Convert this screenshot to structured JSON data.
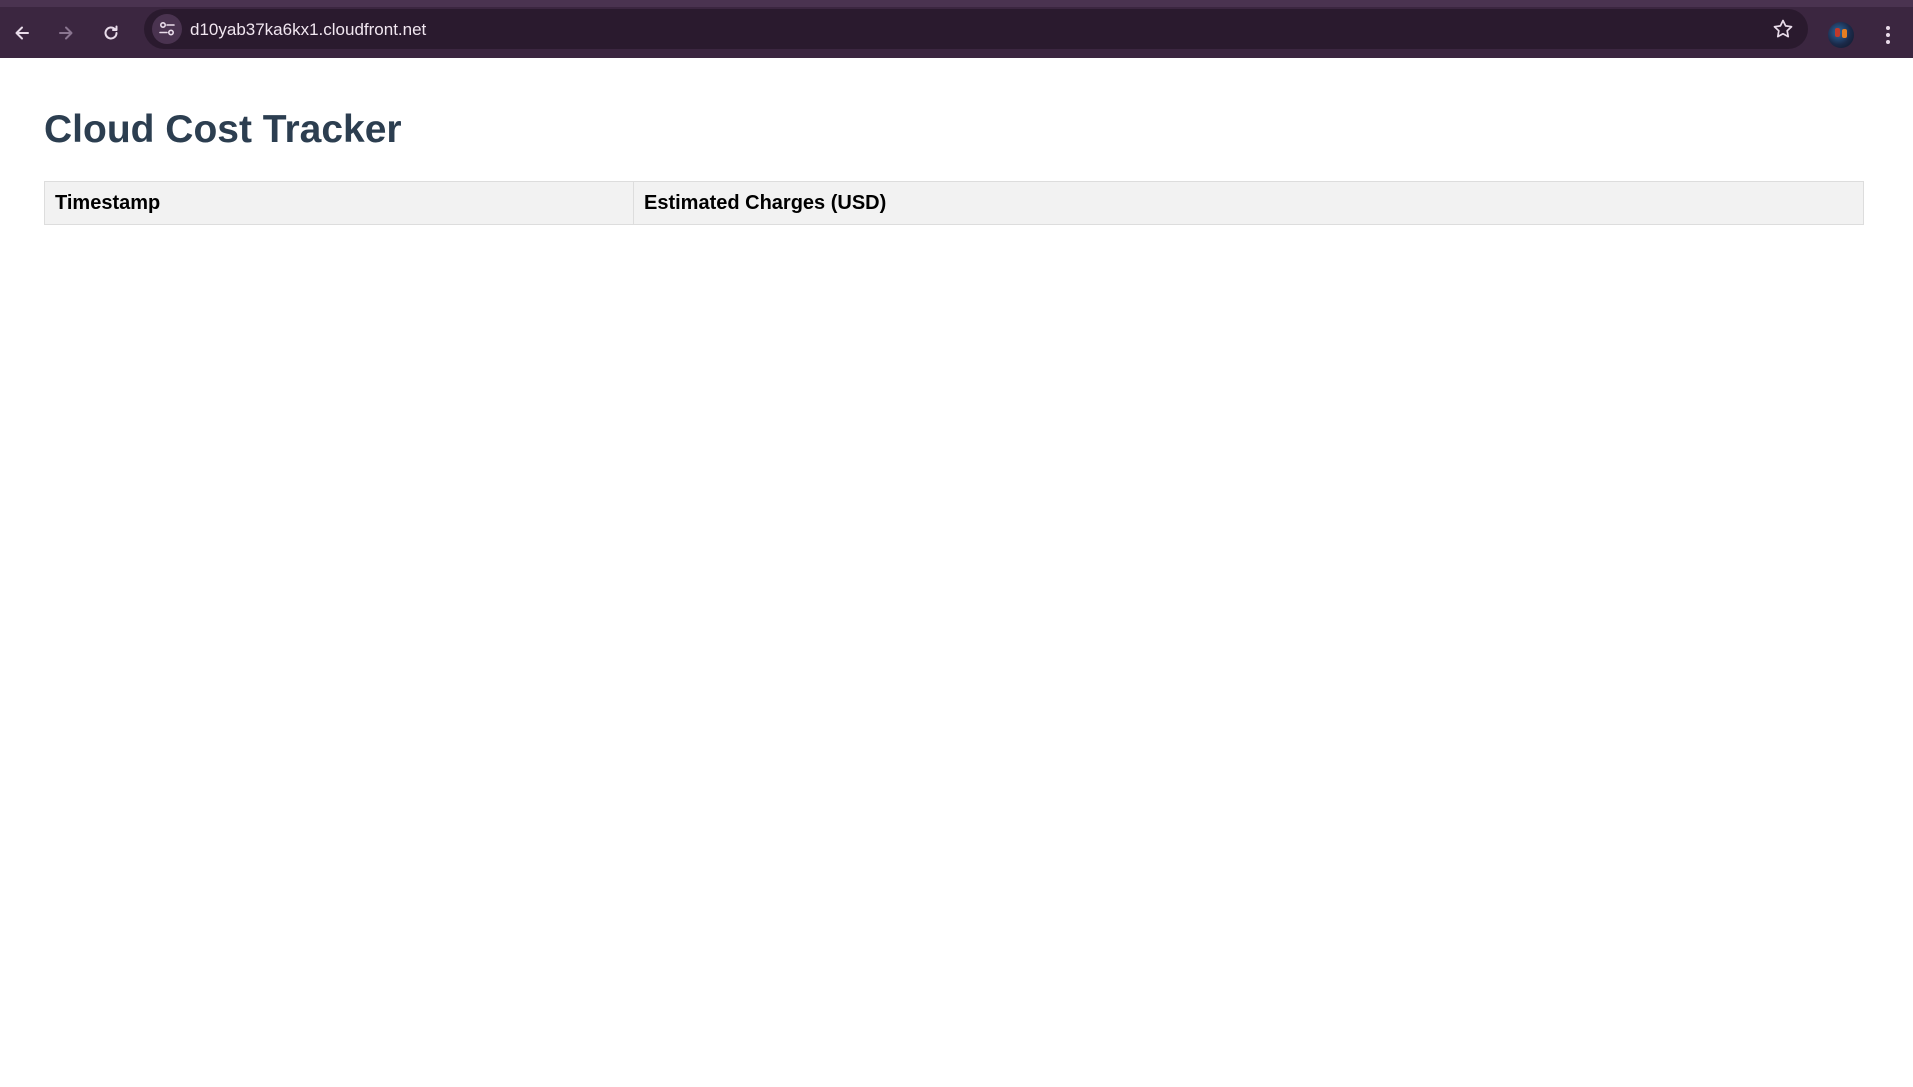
{
  "browser": {
    "url": "d10yab37ka6kx1.cloudfront.net",
    "icons": {
      "back": "arrow-left-icon",
      "forward": "arrow-right-icon",
      "reload": "reload-icon",
      "site_info": "tune-icon",
      "bookmark": "star-icon",
      "menu": "kebab-menu-icon"
    },
    "toolbar_color": "#3b2640"
  },
  "page": {
    "title": "Cloud Cost Tracker",
    "title_color": "#2c3e50",
    "table": {
      "columns": [
        "Timestamp",
        "Estimated Charges (USD)"
      ],
      "rows": []
    }
  }
}
